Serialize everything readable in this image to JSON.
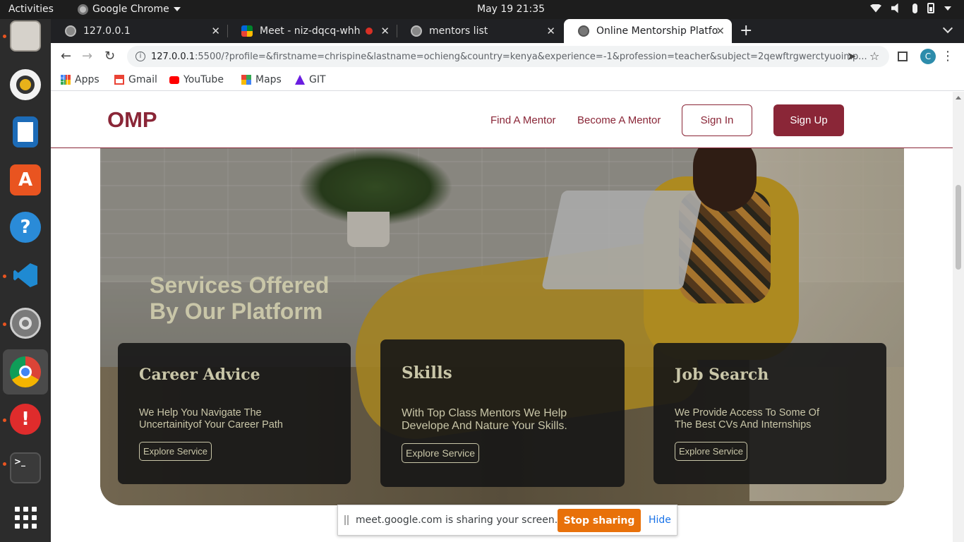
{
  "system": {
    "activities": "Activities",
    "app_name": "Google Chrome",
    "clock": "May 19  21:35"
  },
  "browser": {
    "tabs": [
      {
        "title": "127.0.0.1"
      },
      {
        "title": "Meet - niz-dqcq-whh"
      },
      {
        "title": "mentors list"
      },
      {
        "title": "Online Mentorship Platfo"
      }
    ],
    "new_tab": "+",
    "url_host": "127.0.0.1",
    "url_rest": ":5500/?profile=&firstname=chrispine&lastname=ochieng&country=kenya&experience=-1&profession=teacher&subject=2qewftrgwerctyuoimp...",
    "profile_initial": "C",
    "bookmarks": [
      {
        "label": "Apps"
      },
      {
        "label": "Gmail"
      },
      {
        "label": "YouTube"
      },
      {
        "label": "Maps"
      },
      {
        "label": "GIT"
      }
    ]
  },
  "site": {
    "logo": "OMP",
    "nav": {
      "find_mentor": "Find A Mentor",
      "become_mentor": "Become A Mentor",
      "sign_in": "Sign In",
      "sign_up": "Sign Up"
    },
    "hero": {
      "title_line1": "Services Offered",
      "title_line2": "By Our Platform"
    },
    "cards": [
      {
        "title": "Career Advice",
        "line1": "We Help You Navigate The",
        "line2": "Uncertainityof Your Career Path",
        "button": "Explore Service"
      },
      {
        "title": "Skills",
        "line1": "With Top Class Mentors We Help",
        "line2": "Develope And Nature Your Skills.",
        "button": "Explore Service"
      },
      {
        "title": "Job Search",
        "line1": "We Provide Access To Some Of",
        "line2": "The Best CVs And Internships",
        "button": "Explore Service"
      }
    ]
  },
  "sharebar": {
    "message": "meet.google.com is sharing your screen.",
    "stop": "Stop sharing",
    "hide": "Hide"
  },
  "colors": {
    "brand": "#8a2637",
    "card_text": "#c9c6a8",
    "stop_button": "#e8710a"
  }
}
